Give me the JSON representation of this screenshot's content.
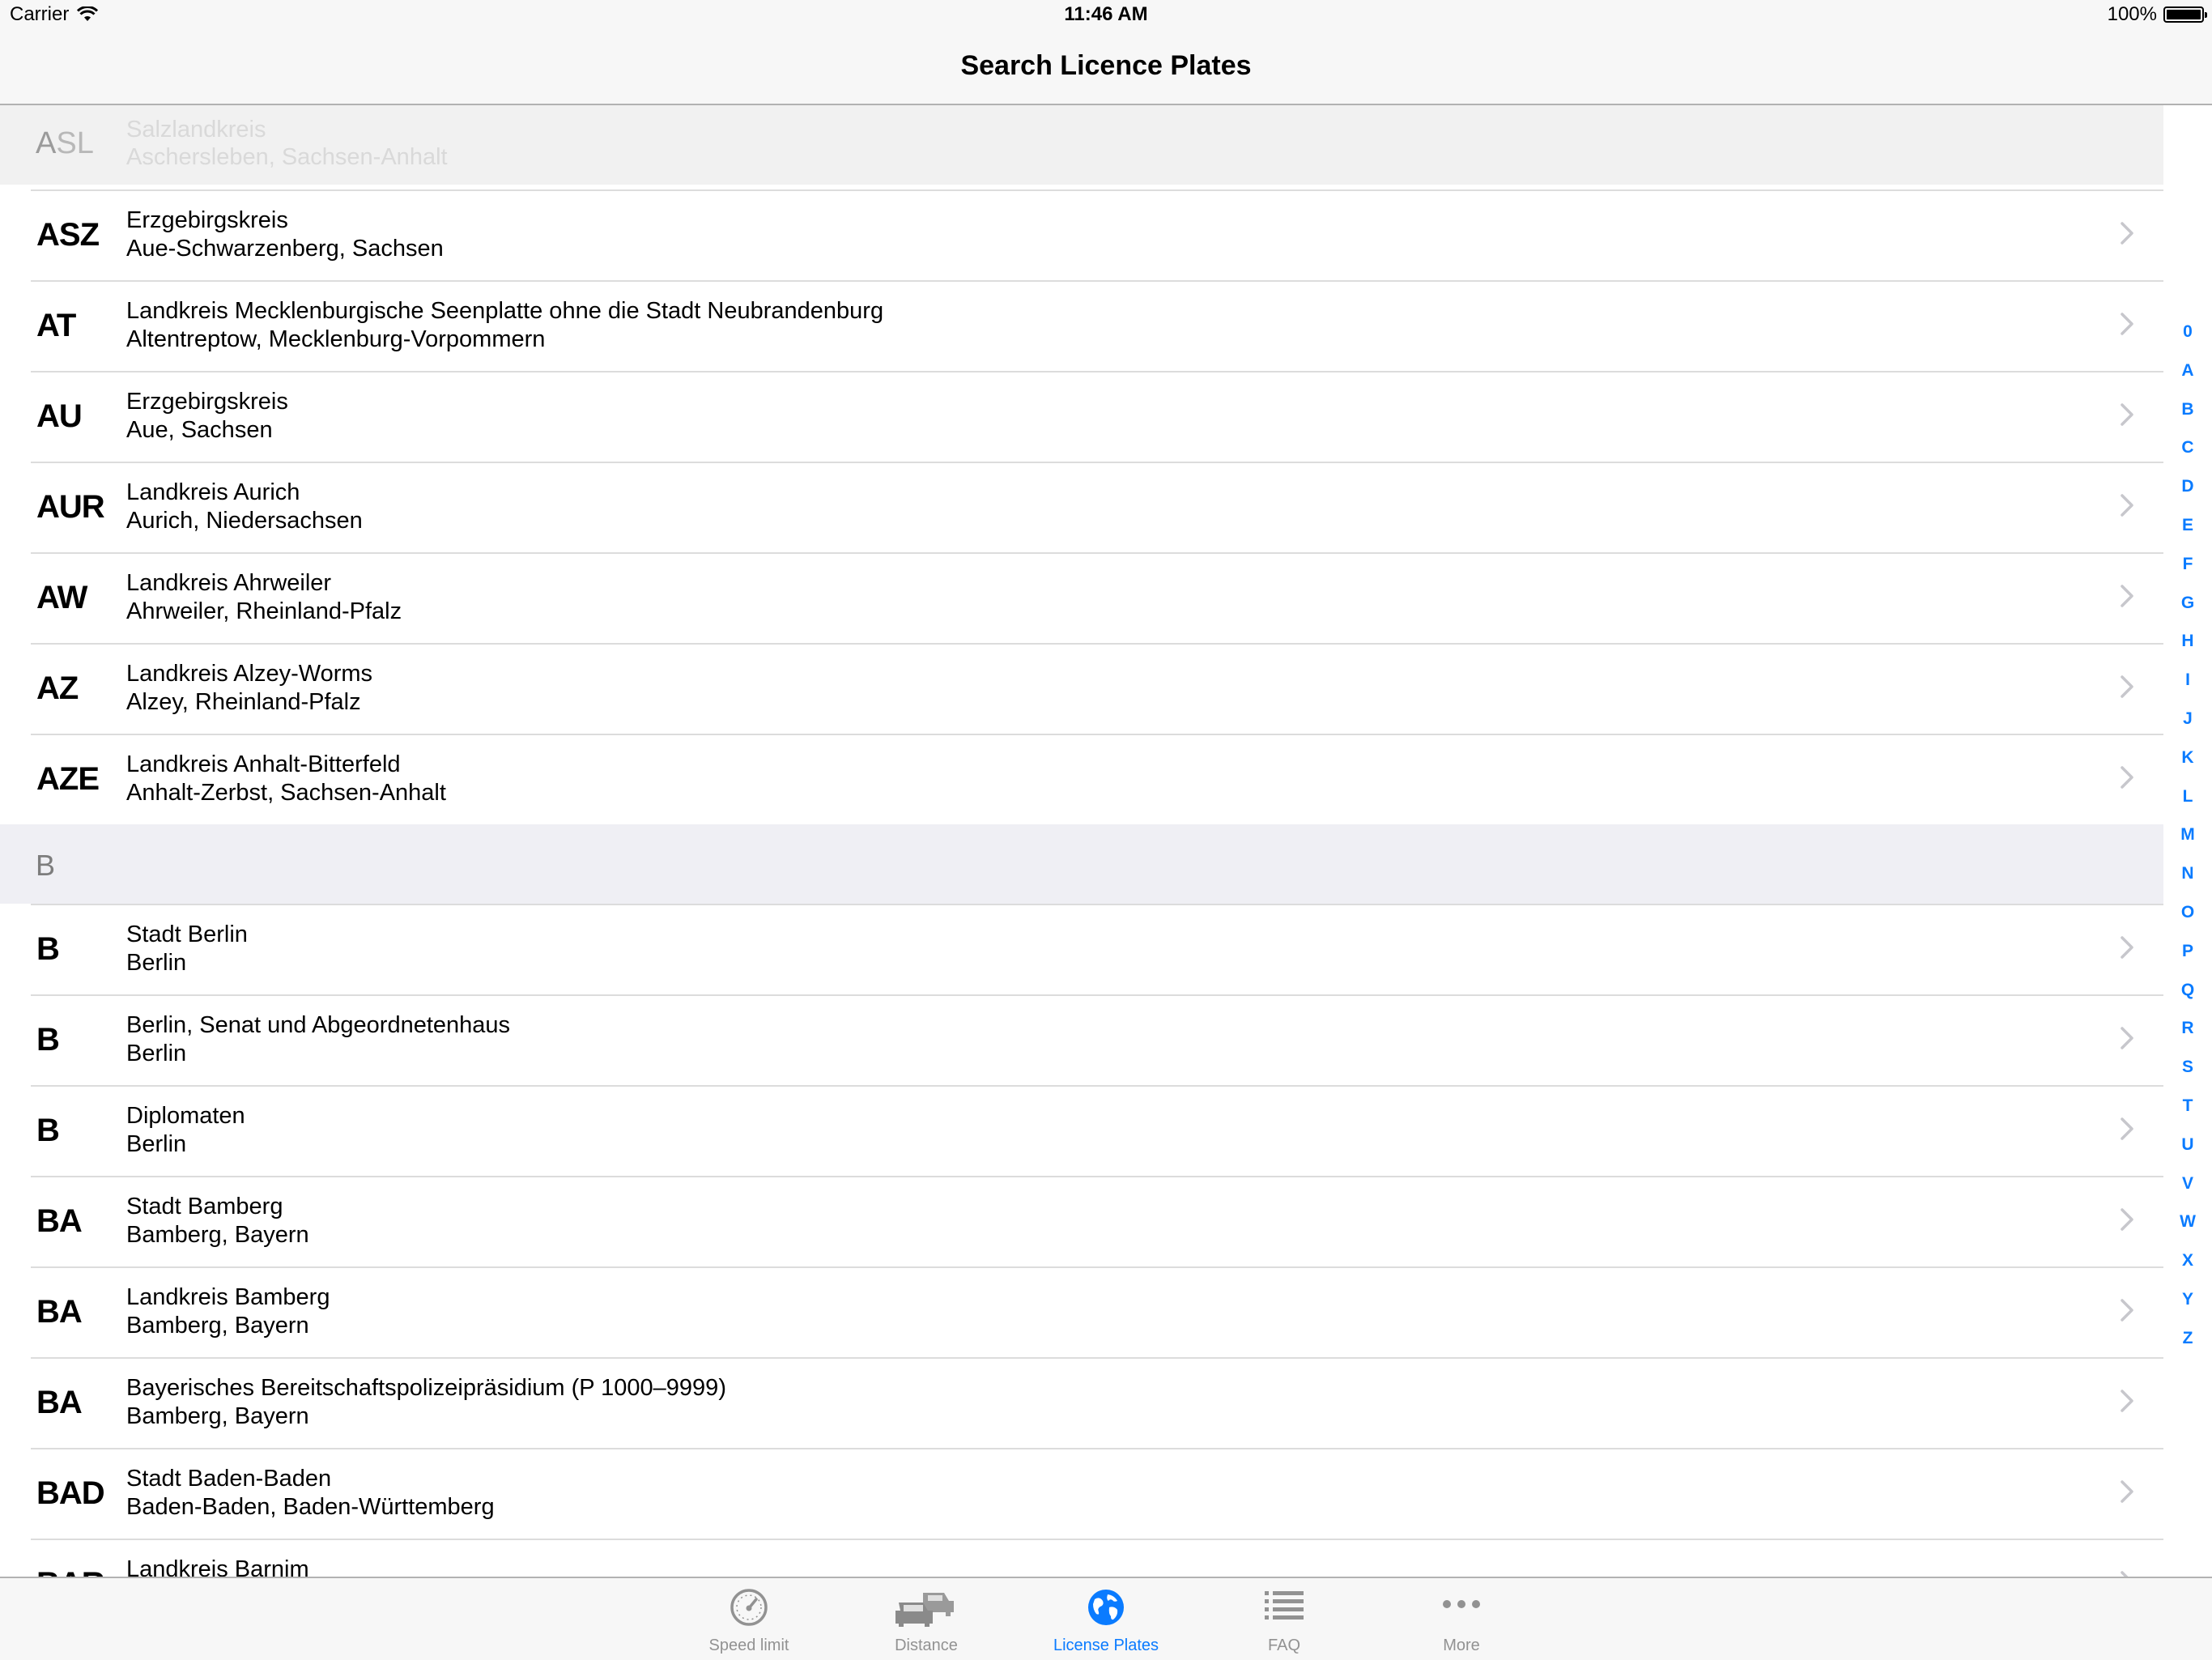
{
  "status_bar": {
    "carrier": "Carrier",
    "time": "11:46 AM",
    "battery": "100%"
  },
  "nav": {
    "title": "Search  Licence Plates"
  },
  "faded_row": {
    "code_first": "A",
    "code_rest": "SL",
    "name": "Salzlandkreis",
    "place": "Aschersleben, Sachsen-Anhalt"
  },
  "rows_a": [
    {
      "code": "ASZ",
      "name": "Erzgebirgskreis",
      "place": "Aue-Schwarzenberg, Sachsen"
    },
    {
      "code": "AT",
      "name": "Landkreis Mecklenburgische Seenplatte ohne die Stadt Neubrandenburg",
      "place": "Altentreptow, Mecklenburg-Vorpommern"
    },
    {
      "code": "AU",
      "name": "Erzgebirgskreis",
      "place": "Aue, Sachsen"
    },
    {
      "code": "AUR",
      "name": "Landkreis Aurich",
      "place": "Aurich, Niedersachsen"
    },
    {
      "code": "AW",
      "name": "Landkreis Ahrweiler",
      "place": "Ahrweiler, Rheinland-Pfalz"
    },
    {
      "code": "AZ",
      "name": "Landkreis Alzey-Worms",
      "place": "Alzey, Rheinland-Pfalz"
    },
    {
      "code": "AZE",
      "name": "Landkreis Anhalt-Bitterfeld",
      "place": "Anhalt-Zerbst, Sachsen-Anhalt"
    }
  ],
  "section_b": {
    "title": "B"
  },
  "rows_b": [
    {
      "code": "B",
      "name": "Stadt Berlin",
      "place": "Berlin"
    },
    {
      "code": "B",
      "name": "Berlin, Senat und Abgeordnetenhaus",
      "place": "Berlin"
    },
    {
      "code": "B",
      "name": "Diplomaten",
      "place": "Berlin"
    },
    {
      "code": "BA",
      "name": "Stadt Bamberg",
      "place": "Bamberg, Bayern"
    },
    {
      "code": "BA",
      "name": "Landkreis Bamberg",
      "place": "Bamberg, Bayern"
    },
    {
      "code": "BA",
      "name": "Bayerisches Bereitschaftspolizeipräsidium (P 1000–9999)",
      "place": "Bamberg, Bayern"
    },
    {
      "code": "BAD",
      "name": "Stadt Baden-Baden",
      "place": "Baden-Baden, Baden-Württemberg"
    },
    {
      "code": "BAR",
      "name": "Landkreis Barnim",
      "place": ""
    }
  ],
  "index": [
    "0",
    "A",
    "B",
    "C",
    "D",
    "E",
    "F",
    "G",
    "H",
    "I",
    "J",
    "K",
    "L",
    "M",
    "N",
    "O",
    "P",
    "Q",
    "R",
    "S",
    "T",
    "U",
    "V",
    "W",
    "X",
    "Y",
    "Z"
  ],
  "tabs": [
    {
      "label": "Speed limit",
      "icon": "speedometer-icon",
      "active": false
    },
    {
      "label": "Distance",
      "icon": "cars-icon",
      "active": false
    },
    {
      "label": "License Plates",
      "icon": "globe-icon",
      "active": true
    },
    {
      "label": "FAQ",
      "icon": "list-icon",
      "active": false
    },
    {
      "label": "More",
      "icon": "more-icon",
      "active": false
    }
  ],
  "colors": {
    "accent": "#0a7bff",
    "tab_inactive": "#929292",
    "section_bg": "#efeff4"
  }
}
